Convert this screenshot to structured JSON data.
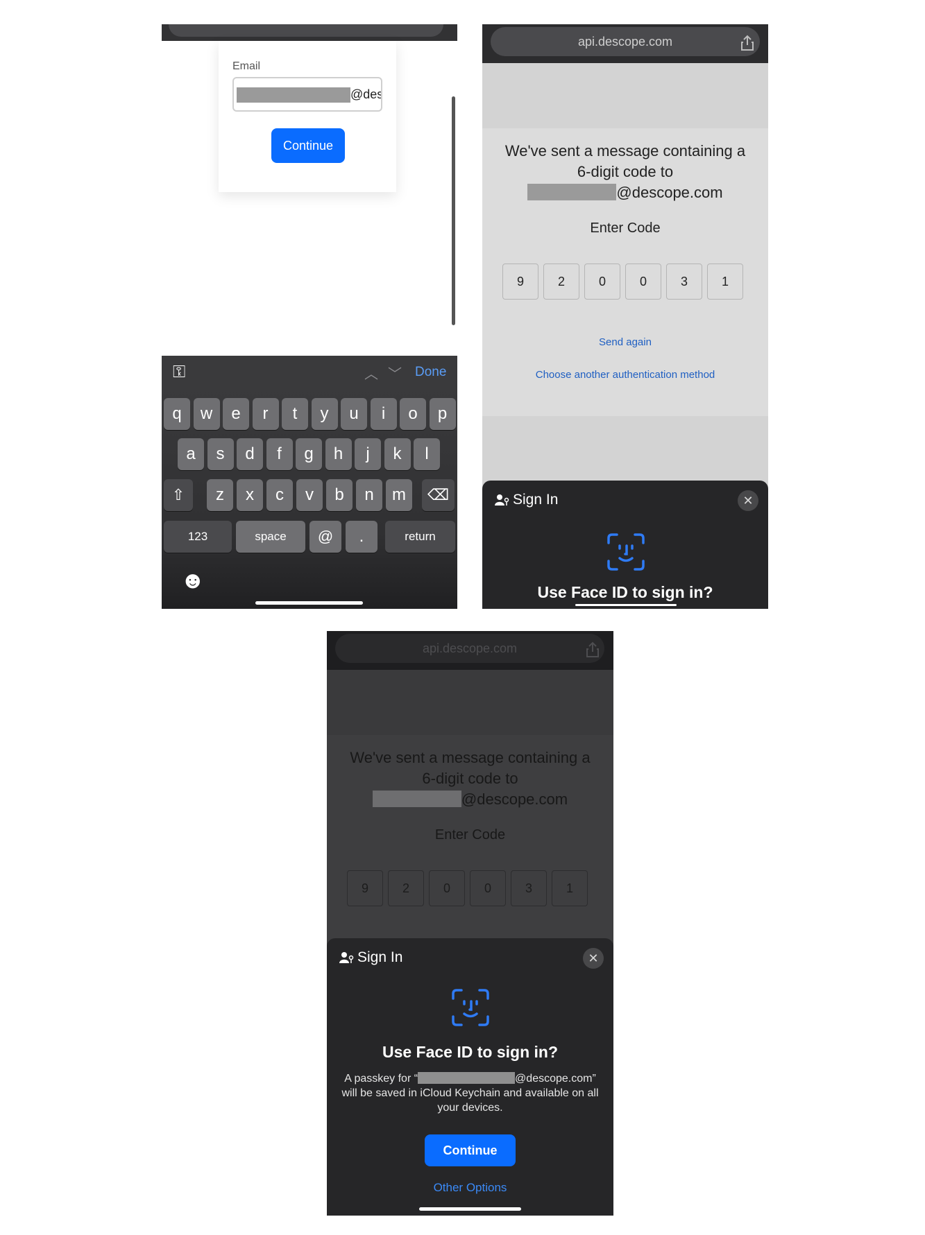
{
  "panel1": {
    "email_label": "Email",
    "email_suffix": "@des",
    "continue_label": "Continue",
    "keyboard": {
      "done_label": "Done",
      "row1": [
        "q",
        "w",
        "e",
        "r",
        "t",
        "y",
        "u",
        "i",
        "o",
        "p"
      ],
      "row2": [
        "a",
        "s",
        "d",
        "f",
        "g",
        "h",
        "j",
        "k",
        "l"
      ],
      "row3": [
        "z",
        "x",
        "c",
        "v",
        "b",
        "n",
        "m"
      ],
      "numbers_label": "123",
      "space_label": "space",
      "at_label": "@",
      "dot_label": ".",
      "return_label": "return",
      "shift_glyph": "⇧",
      "backspace_glyph": "⌫",
      "emoji_glyph": "☻",
      "key_glyph": "⚿",
      "prev_glyph": "︿",
      "next_glyph": "﹀"
    }
  },
  "panel2": {
    "url": "api.descope.com",
    "message_line1": "We've sent a message containing a",
    "message_line2": "6-digit code to",
    "email_suffix": "@descope.com",
    "enter_code": "Enter Code",
    "code_digits": [
      "9",
      "2",
      "0",
      "0",
      "3",
      "1"
    ],
    "send_again": "Send again",
    "choose_another": "Choose another authentication method",
    "dialog": {
      "title": "Sign In",
      "heading": "Use Face ID to sign in?",
      "close_glyph": "✕"
    }
  },
  "panel3": {
    "url": "api.descope.com",
    "message_line1": "We've sent a message containing a",
    "message_line2": "6-digit code to",
    "email_suffix": "@descope.com",
    "enter_code": "Enter Code",
    "code_digits": [
      "9",
      "2",
      "0",
      "0",
      "3",
      "1"
    ],
    "dialog": {
      "title": "Sign In",
      "heading": "Use Face ID to sign in?",
      "desc_prefix": "A passkey for “",
      "desc_suffix": "@descope.com”",
      "desc_line2": "will be saved in iCloud Keychain and available on all",
      "desc_line3": "your devices.",
      "continue_label": "Continue",
      "other_options": "Other Options",
      "close_glyph": "✕"
    }
  },
  "colors": {
    "accent": "#0a6cff",
    "link": "#1f5fc2",
    "faceid": "#2f7bf5"
  }
}
